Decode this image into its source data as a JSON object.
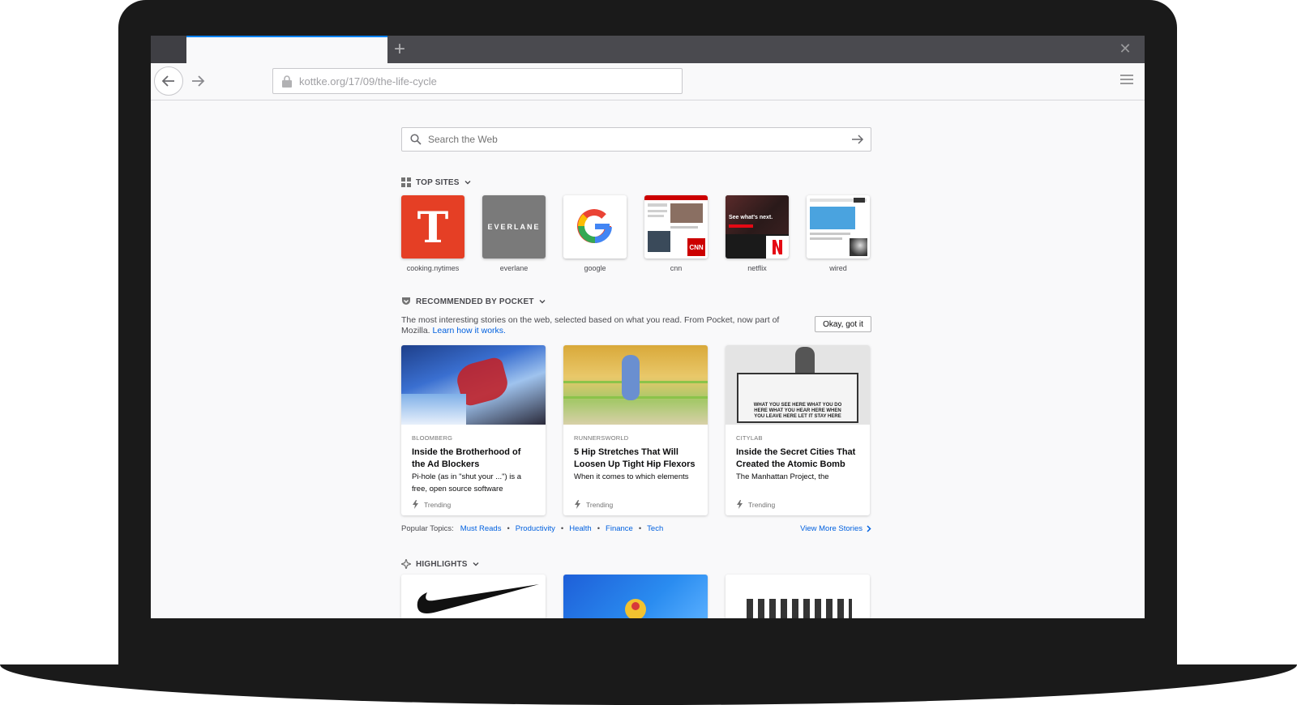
{
  "browser": {
    "url": "kottke.org/17/09/the-life-cycle",
    "accent_color": "#0a84ff",
    "icons": {
      "new_tab": "plus-icon",
      "close": "close-icon",
      "back": "back-arrow-icon",
      "forward": "forward-arrow-icon",
      "lock": "lock-icon",
      "menu": "hamburger-menu-icon"
    },
    "new_tab_glyph": "+",
    "close_glyph": "✕"
  },
  "search": {
    "placeholder": "Search the Web"
  },
  "top_sites": {
    "heading": "TOP SITES",
    "sites": [
      {
        "label": "cooking.nytimes",
        "color": "#e53f25"
      },
      {
        "label": "everlane",
        "color": "#7a7a7a",
        "logo_text": "EVERLANE"
      },
      {
        "label": "google",
        "color": "#ffffff"
      },
      {
        "label": "cnn",
        "color": "#ffffff"
      },
      {
        "label": "netflix",
        "color": "#1a1a1a",
        "tile_text": "See what's next."
      },
      {
        "label": "wired",
        "color": "#ffffff"
      }
    ]
  },
  "pocket": {
    "heading": "RECOMMENDED BY POCKET",
    "description": "The most interesting stories on the web, selected based on what you read. From Pocket, now part of Mozilla.",
    "learn_link": "Learn how it works.",
    "okay_button": "Okay, got it",
    "cards": [
      {
        "source": "BLOOMBERG",
        "title": "Inside the Brotherhood of the Ad Blockers",
        "excerpt": "Pi-hole (as in \"shut your ...\") is a free, open source software",
        "badge": "Trending"
      },
      {
        "source": "RUNNERSWORLD",
        "title": "5 Hip Stretches That Will Loosen Up Tight Hip Flexors",
        "excerpt": "When it comes to which elements",
        "badge": "Trending"
      },
      {
        "source": "CITYLAB",
        "title": "Inside the Secret Cities That Created the Atomic Bomb",
        "excerpt": "The Manhattan Project, the",
        "badge": "Trending",
        "image_caption": "WHAT YOU SEE HERE WHAT YOU DO HERE WHAT YOU HEAR HERE WHEN YOU LEAVE HERE LET IT STAY HERE"
      }
    ],
    "topics_label": "Popular Topics:",
    "topics": [
      "Must Reads",
      "Productivity",
      "Health",
      "Finance",
      "Tech"
    ],
    "view_more": "View More Stories"
  },
  "highlights": {
    "heading": "HIGHLIGHTS"
  }
}
